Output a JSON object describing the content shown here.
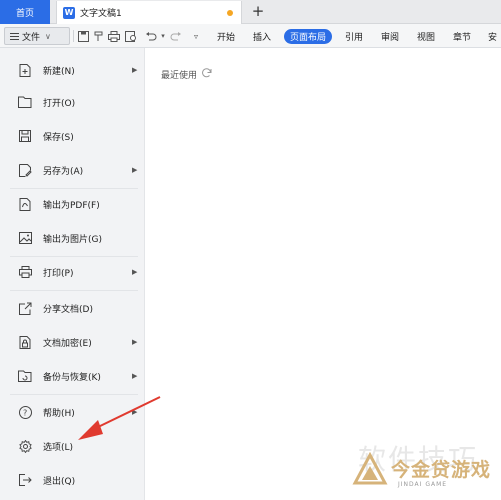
{
  "tabs": {
    "home_label": "首页",
    "doc_icon_letter": "W",
    "doc_title": "文字文稿1",
    "new_tab": "+"
  },
  "toolbar": {
    "file_label": "文件",
    "file_chevron": "∨",
    "tabs": [
      "开始",
      "插入",
      "页面布局",
      "引用",
      "审阅",
      "视图",
      "章节",
      "安"
    ],
    "active_tab": "页面布局",
    "active_color": "#2b6de6"
  },
  "file_menu": {
    "items": [
      {
        "label": "新建(N)",
        "icon": "new-icon",
        "has_submenu": true
      },
      {
        "label": "打开(O)",
        "icon": "open-folder-icon",
        "has_submenu": false
      },
      {
        "label": "保存(S)",
        "icon": "save-icon",
        "has_submenu": false
      },
      {
        "label": "另存为(A)",
        "icon": "save-as-icon",
        "has_submenu": true
      },
      {
        "label": "输出为PDF(F)",
        "icon": "pdf-icon",
        "has_submenu": false
      },
      {
        "label": "输出为图片(G)",
        "icon": "image-icon",
        "has_submenu": false
      },
      {
        "label": "打印(P)",
        "icon": "print-icon",
        "has_submenu": true
      },
      {
        "label": "分享文档(D)",
        "icon": "share-icon",
        "has_submenu": false
      },
      {
        "label": "文档加密(E)",
        "icon": "encrypt-icon",
        "has_submenu": true
      },
      {
        "label": "备份与恢复(K)",
        "icon": "backup-icon",
        "has_submenu": true
      },
      {
        "label": "帮助(H)",
        "icon": "help-icon",
        "has_submenu": true
      },
      {
        "label": "选项(L)",
        "icon": "gear-icon",
        "has_submenu": false
      },
      {
        "label": "退出(Q)",
        "icon": "exit-icon",
        "has_submenu": false
      }
    ]
  },
  "panel": {
    "recent_label": "最近使用"
  },
  "watermark": {
    "big_text": "软件技巧",
    "brand_text": "今金贷游戏",
    "brand_sub": "JINDAI GAME",
    "brand_color": "#d6b37a"
  },
  "annotation": {
    "arrow_color": "#e03a2f"
  }
}
